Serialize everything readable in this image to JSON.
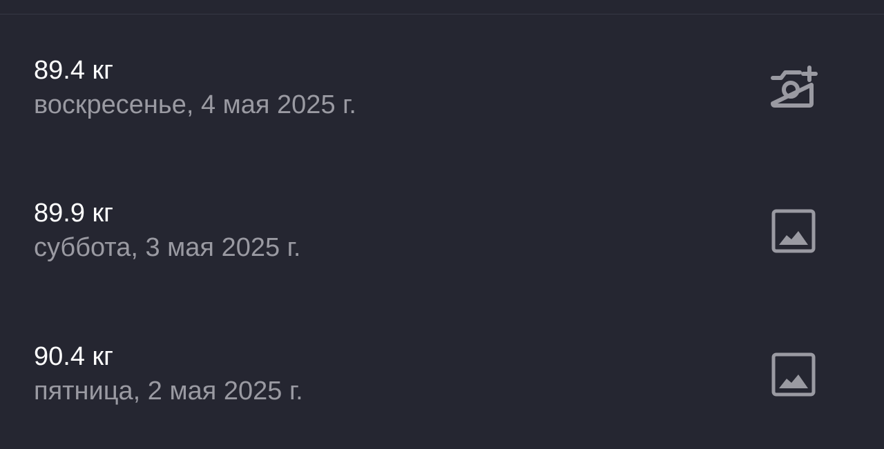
{
  "entries": [
    {
      "weight": "89.4 кг",
      "date": "воскресенье, 4 мая 2025 г.",
      "icon": "camera-add-icon"
    },
    {
      "weight": "89.9 кг",
      "date": "суббота, 3 мая 2025 г.",
      "icon": "image-icon"
    },
    {
      "weight": "90.4 кг",
      "date": "пятница, 2 мая 2025 г.",
      "icon": "image-icon"
    }
  ],
  "colors": {
    "background": "#252631",
    "primary_text": "#ffffff",
    "secondary_text": "#9a9aa2",
    "icon": "#9a9aa2",
    "divider": "#363845"
  }
}
